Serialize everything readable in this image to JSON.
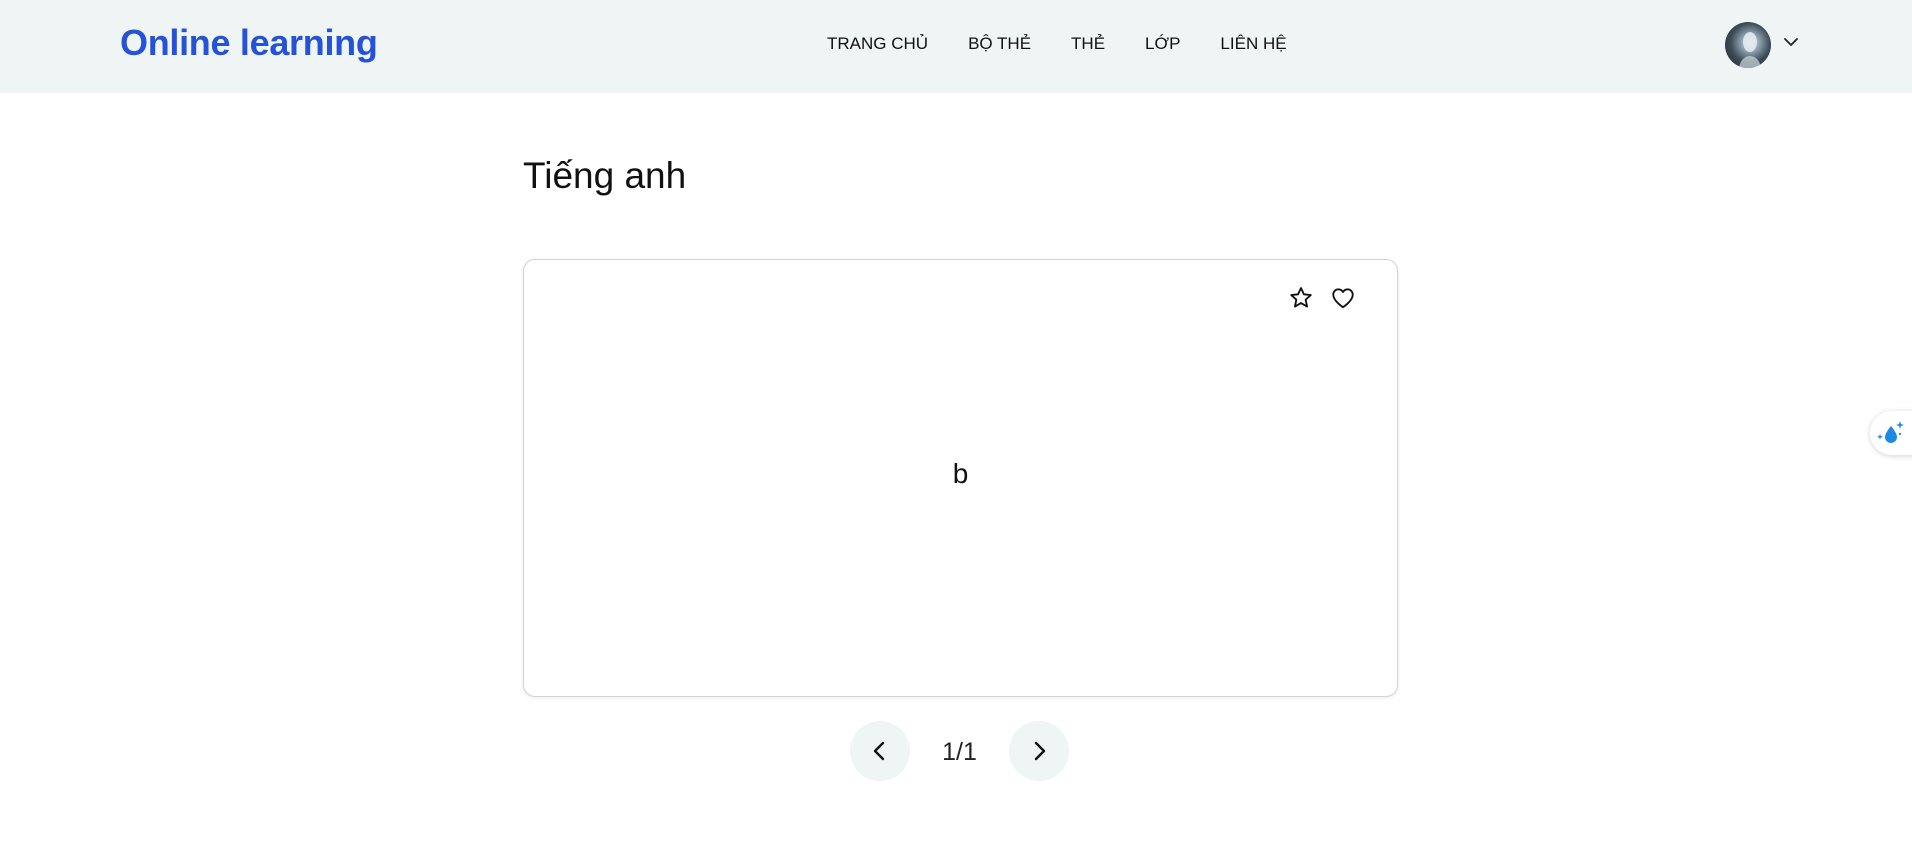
{
  "header": {
    "logo": "Online learning",
    "nav": [
      {
        "label": "TRANG CHỦ"
      },
      {
        "label": "BỘ THẺ"
      },
      {
        "label": "THẺ"
      },
      {
        "label": "LỚP"
      },
      {
        "label": "LIÊN HỆ"
      }
    ],
    "avatar_icon": "user-avatar",
    "menu_icon": "chevron-down-icon"
  },
  "main": {
    "title": "Tiếng anh",
    "card": {
      "text": "b",
      "icons": [
        "star-icon",
        "heart-icon"
      ]
    },
    "pager": {
      "count": "1/1",
      "prev_icon": "chevron-left-icon",
      "next_icon": "chevron-right-icon"
    }
  },
  "side_widget": {
    "icon": "water-drop-sparkle-icon"
  },
  "colors": {
    "brand": "#2552d6",
    "header_bg": "#eff4f4",
    "widget_accent": "#1e88e5"
  }
}
